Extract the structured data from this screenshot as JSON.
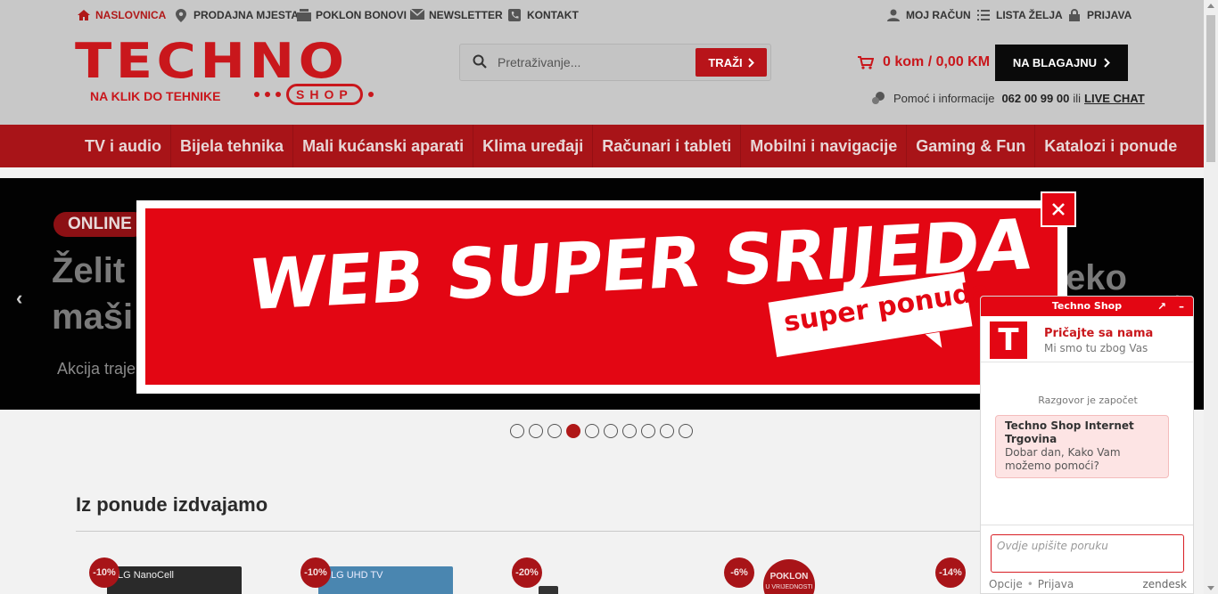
{
  "topbar": {
    "home": "NASLOVNICA",
    "stores": "PRODAJNA MJESTA",
    "vouchers": "POKLON BONOVI",
    "newsletter": "NEWSLETTER",
    "contact": "KONTAKT",
    "account": "MOJ RAČUN",
    "wishlist": "LISTA ŽELJA",
    "login": "PRIJAVA"
  },
  "logo": {
    "main": "TECHNO",
    "shop": "SHOP",
    "tagline": "NA KLIK DO TEHNIKE"
  },
  "search": {
    "placeholder": "Pretraživanje...",
    "button": "TRAŽI"
  },
  "cart": {
    "summary": "0 kom / 0,00 KM",
    "checkout": "NA BLAGAJNU"
  },
  "help": {
    "text": "Pomoć i informacije",
    "phone": "062 00 99 00",
    "or": "ili",
    "live_chat": "LIVE CHAT"
  },
  "nav": [
    "TV i audio",
    "Bijela tehnika",
    "Mali kućanski aparati",
    "Klima uređaji",
    "Računari i tableti",
    "Mobilni i navigacije",
    "Gaming & Fun",
    "Katalozi i ponude"
  ],
  "hero": {
    "badge": "ONLINE",
    "line1": "Želit",
    "line2": "maši",
    "sub": "Akcija traje",
    "right": "eko",
    "prev": "‹",
    "next": "›"
  },
  "slider": {
    "count": 10,
    "active": 3
  },
  "section": {
    "title": "Iz ponude izdvajamo"
  },
  "products": [
    {
      "discount": "-10%",
      "brand": "LG NanoCell"
    },
    {
      "discount": "-10%",
      "brand": "LG UHD TV"
    },
    {
      "discount": "-20%"
    },
    {
      "discount": "-6%",
      "gift": "POKLON",
      "gift_sub": "U VRIJEDNOSTI"
    },
    {
      "discount": "-14%"
    }
  ],
  "modal": {
    "headline": "WEB SUPER SRIJEDA",
    "ribbon": "super ponuda",
    "close": "✕"
  },
  "chat": {
    "title": "Techno Shop",
    "agent_name": "Pričajte sa nama",
    "agent_sub": "Mi smo tu zbog Vas",
    "started": "Razgovor je započet",
    "sender": "Techno Shop Internet Trgovina",
    "message": "Dobar dan, Kako Vam možemo pomoći?",
    "input_placeholder": "Ovdje upišite poruku",
    "options": "Opcije",
    "separator": "•",
    "login": "Prijava",
    "brand": "zendesk"
  },
  "colors": {
    "brand_red": "#e30613",
    "dark_red": "#a81418",
    "checkout_bg": "#0a0a0a"
  }
}
